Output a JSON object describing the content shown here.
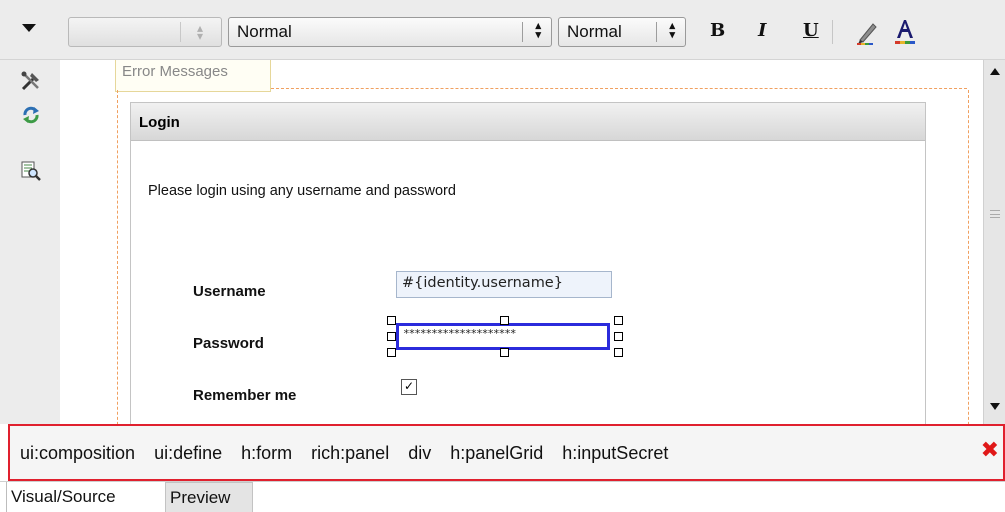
{
  "toolbar": {
    "font_name_value": "",
    "paragraph_style_value": "Normal",
    "font_size_value": "Normal",
    "bold_label": "B",
    "italic_label": "I",
    "underline_label": "U",
    "icons": [
      "dropdown-arrow-icon",
      "pen-icon",
      "font-color-icon"
    ]
  },
  "palette": {
    "icons": [
      "tools-icon",
      "refresh-icon",
      "search-page-icon"
    ]
  },
  "canvas": {
    "error_messages_label": "Error Messages",
    "panel_title": "Login",
    "panel_text": "Please login using any username and password",
    "username_label": "Username",
    "username_value": "#{identity.username}",
    "password_label": "Password",
    "password_value": "********************",
    "remember_label": "Remember me",
    "remember_checked": true,
    "checkmark": "✓"
  },
  "breadcrumb": {
    "items": [
      "ui:composition",
      "ui:define",
      "h:form",
      "rich:panel",
      "div",
      "h:panelGrid",
      "h:inputSecret"
    ],
    "close_glyph": "✖"
  },
  "tabs": {
    "visual_source": "Visual/Source",
    "preview": "Preview"
  },
  "colors": {
    "selection_border": "#2b2bdc",
    "breadcrumb_border": "#e0202e",
    "close_red": "#e01818"
  }
}
